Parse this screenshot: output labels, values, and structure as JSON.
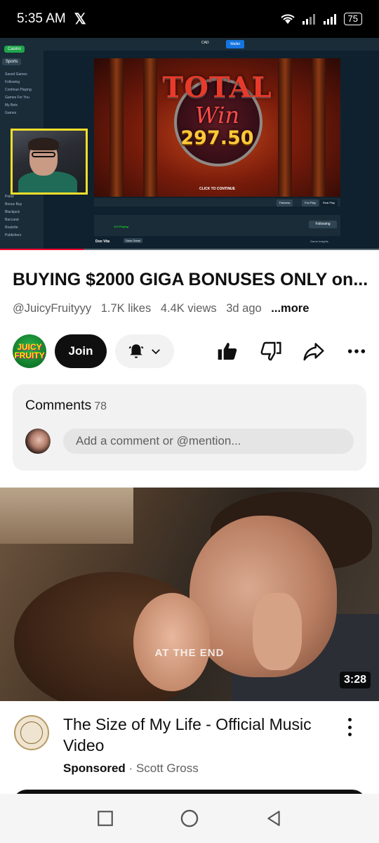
{
  "status_bar": {
    "time": "5:35 AM",
    "x_logo": "𝕏",
    "battery": "75"
  },
  "player": {
    "casino": {
      "tabs": [
        "Casino",
        "Sports"
      ],
      "sidebar_items": [
        "Saved Games",
        "Following",
        "Continue Playing",
        "Games For You",
        "My Bets",
        "Games",
        "Poker",
        "Bonus Buy",
        "Blackjack",
        "Baccarat",
        "Roulette",
        "Publishers"
      ],
      "currency": "CAD",
      "wallet_label": "Wallet",
      "fairness_label": "Fairness",
      "fun_play_label": "Fun Play",
      "real_play_label": "Real Play",
      "following_label": "Following",
      "game_insights_label": "Game Insights",
      "provider_label": "Don Vita",
      "save_game_label": "Save Game",
      "playing_count": "129 Playing",
      "click_to_continue": "CLICK TO CONTINUE"
    },
    "win_title": "TOTAL",
    "win_subtitle": "Win",
    "win_amount": "297.50",
    "progress": 0.22
  },
  "video": {
    "title": "BUYING $2000 GIGA BONUSES ONLY on...",
    "channel_handle": "@JuicyFruityyy",
    "likes": "1.7K likes",
    "views": "4.4K views",
    "age": "3d ago",
    "more_label": "...more",
    "channel_avatar_text": "JUICY FRUITY"
  },
  "actions": {
    "join_label": "Join",
    "icons": [
      "bell-icon",
      "chevron-down-icon",
      "like-icon",
      "dislike-icon",
      "share-icon",
      "more-icon"
    ]
  },
  "comments": {
    "title": "Comments",
    "count": "78",
    "placeholder": "Add a comment or @mention..."
  },
  "ad": {
    "caption": "AT THE END",
    "duration": "3:28",
    "title": "The Size of My Life - Official Music Video",
    "sponsored_label": "Sponsored",
    "separator": "·",
    "advertiser": "Scott Gross"
  },
  "nav": {
    "icons": [
      "recents-icon",
      "home-icon",
      "back-icon"
    ]
  },
  "colors": {
    "accent": "#ff0033",
    "text_primary": "#0f0f0f",
    "text_secondary": "#606060",
    "chip_bg": "#f2f2f2",
    "webcam_border": "#f3de2c",
    "casino_bg": "#0f212e"
  }
}
